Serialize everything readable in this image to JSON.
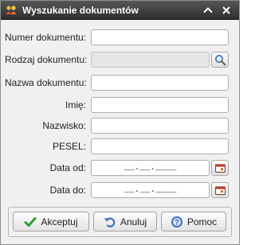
{
  "window": {
    "title": "Wyszukanie dokumentów"
  },
  "form": {
    "document_number_label": "Numer dokumentu:",
    "document_number_value": "",
    "document_type_label": "Rodzaj dokumentu:",
    "document_type_value": "",
    "document_name_label": "Nazwa dokumentu:",
    "document_name_value": "",
    "first_name_label": "Imię:",
    "first_name_value": "",
    "last_name_label": "Nazwisko:",
    "last_name_value": "",
    "pesel_label": "PESEL:",
    "pesel_value": "",
    "date_from_label": "Data od:",
    "date_from_value": "__.__.____",
    "date_to_label": "Data do:",
    "date_to_value": "__.__.____"
  },
  "buttons": {
    "accept_label": "Akceptuj",
    "cancel_label": "Anuluj",
    "help_label": "Pomoc"
  },
  "icons": {
    "app": "users-icon",
    "collapse": "chevron-up-icon",
    "close": "close-icon",
    "lookup": "magnifier-icon",
    "calendar": "calendar-icon",
    "accept": "checkmark-icon",
    "cancel": "undo-icon",
    "help": "help-icon"
  },
  "colors": {
    "titlebar": "#3f3f3f",
    "window_bg": "#f0f0f0",
    "accept_icon": "#2e9e2e",
    "help_icon": "#3b6fc4"
  }
}
